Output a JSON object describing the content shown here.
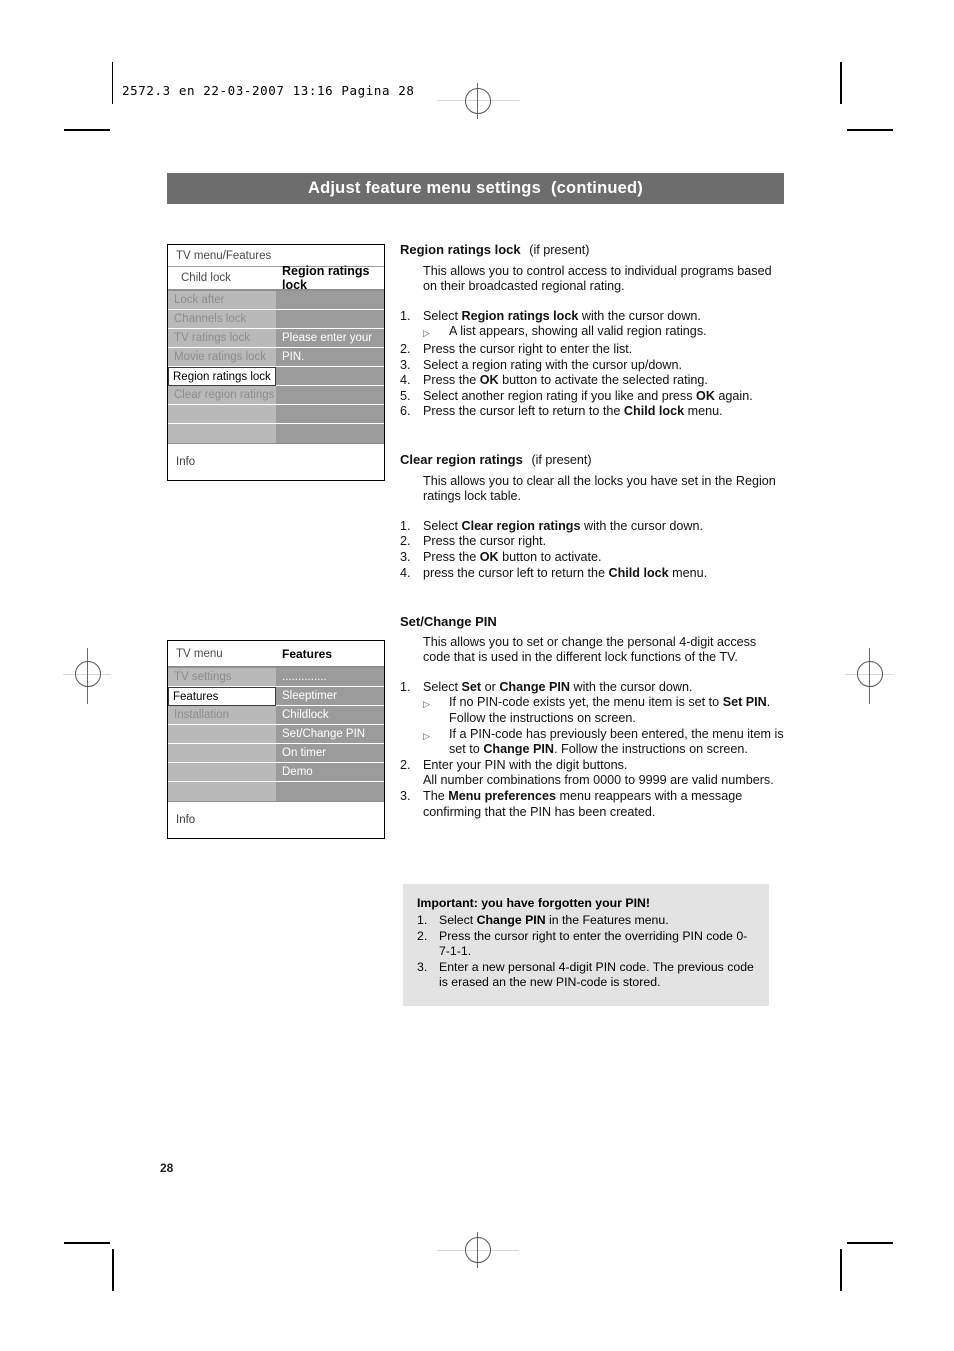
{
  "print_marks": {
    "job_code": "2572.3 en   22-03-2007   13:16   Pagina 28"
  },
  "header": {
    "title": "Adjust feature menu settings",
    "continued": "(continued)"
  },
  "page_number": "28",
  "menu_screens": [
    {
      "name": "region-ratings-lock-menu",
      "breadcrumb": "TV menu/Features",
      "header_left": "Child lock",
      "header_right": "Region ratings lock",
      "rows": [
        {
          "left": "Lock after",
          "right": "",
          "selected": false
        },
        {
          "left": "Channels lock",
          "right": "",
          "selected": false
        },
        {
          "left": "TV ratings lock",
          "right": "Please enter your",
          "selected": false
        },
        {
          "left": "Movie ratings lock",
          "right": "PIN.",
          "selected": false
        },
        {
          "left": "Region ratings lock",
          "right": "",
          "selected": true
        },
        {
          "left": "Clear region ratings",
          "right": "",
          "selected": false
        },
        {
          "left": "",
          "right": "",
          "selected": false
        },
        {
          "left": "",
          "right": "",
          "selected": false
        }
      ],
      "info": "Info"
    },
    {
      "name": "features-menu",
      "breadcrumb": "TV menu",
      "header_right": "Features",
      "rows": [
        {
          "left": "TV settings",
          "right": "..............",
          "selected": false
        },
        {
          "left": "Features",
          "right": "Sleeptimer",
          "selected": true
        },
        {
          "left": "Installation",
          "right": "Childlock",
          "selected": false
        },
        {
          "left": "",
          "right": "Set/Change PIN",
          "selected": false
        },
        {
          "left": "",
          "right": "On timer",
          "selected": false
        },
        {
          "left": "",
          "right": "Demo",
          "selected": false
        },
        {
          "left": "",
          "right": "",
          "selected": false
        }
      ],
      "info": "Info"
    }
  ],
  "sections": {
    "region_ratings_lock": {
      "heading": "Region ratings lock",
      "heading_note": "(if present)",
      "intro": "This allows you to control access to individual programs based on their broadcasted regional rating.",
      "steps": [
        {
          "num": "1.",
          "parts": [
            {
              "t": "Select "
            },
            {
              "t": "Region ratings lock",
              "b": true
            },
            {
              "t": " with the cursor down."
            }
          ]
        },
        {
          "sub": true,
          "parts": [
            {
              "t": "A list appears, showing all valid region ratings."
            }
          ]
        },
        {
          "num": "2.",
          "parts": [
            {
              "t": "Press the cursor right to enter the list."
            }
          ]
        },
        {
          "num": "3.",
          "parts": [
            {
              "t": "Select a region rating with the cursor up/down."
            }
          ]
        },
        {
          "num": "4.",
          "parts": [
            {
              "t": "Press the "
            },
            {
              "t": "OK",
              "b": true
            },
            {
              "t": " button to activate the selected rating."
            }
          ]
        },
        {
          "num": "5.",
          "parts": [
            {
              "t": "Select another region rating if you like and press "
            },
            {
              "t": "OK",
              "b": true
            },
            {
              "t": " again."
            }
          ]
        },
        {
          "num": "6.",
          "parts": [
            {
              "t": "Press the cursor left to return to the "
            },
            {
              "t": "Child lock",
              "b": true
            },
            {
              "t": " menu."
            }
          ]
        }
      ]
    },
    "clear_region_ratings": {
      "heading": "Clear region ratings",
      "heading_note": "(if present)",
      "intro": "This allows you to clear all the locks you have set in the Region ratings lock table.",
      "steps": [
        {
          "num": "1.",
          "parts": [
            {
              "t": "Select "
            },
            {
              "t": "Clear region ratings",
              "b": true
            },
            {
              "t": " with the cursor down."
            }
          ]
        },
        {
          "num": "2.",
          "parts": [
            {
              "t": "Press the cursor right."
            }
          ]
        },
        {
          "num": "3.",
          "parts": [
            {
              "t": "Press the "
            },
            {
              "t": "OK",
              "b": true
            },
            {
              "t": " button to activate."
            }
          ]
        },
        {
          "num": "4.",
          "parts": [
            {
              "t": "press the cursor left to return the "
            },
            {
              "t": "Child lock",
              "b": true
            },
            {
              "t": " menu."
            }
          ]
        }
      ]
    },
    "set_change_pin": {
      "heading": "Set/Change PIN",
      "heading_note": "",
      "intro": "This allows you to set or change the personal 4-digit access code that is used in the different lock functions of the TV.",
      "steps": [
        {
          "num": "1.",
          "parts": [
            {
              "t": "Select "
            },
            {
              "t": "Set",
              "b": true
            },
            {
              "t": " or "
            },
            {
              "t": "Change PIN",
              "b": true
            },
            {
              "t": " with the cursor down."
            }
          ]
        },
        {
          "sub": true,
          "parts": [
            {
              "t": "If no PIN-code exists yet, the menu item is set to "
            },
            {
              "t": "Set PIN",
              "b": true
            },
            {
              "t": ". Follow the instructions on screen."
            }
          ]
        },
        {
          "sub": true,
          "parts": [
            {
              "t": "If a PIN-code has previously been entered, the menu item is set to "
            },
            {
              "t": "Change PIN",
              "b": true
            },
            {
              "t": ". Follow the instructions on screen."
            }
          ]
        },
        {
          "num": "2.",
          "parts": [
            {
              "t": "Enter your PIN with the digit buttons.\nAll number combinations from 0000 to 9999 are valid numbers."
            }
          ]
        },
        {
          "num": "3.",
          "parts": [
            {
              "t": "The "
            },
            {
              "t": "Menu preferences",
              "b": true
            },
            {
              "t": " menu reappears with a message confirming that the PIN has been created."
            }
          ]
        }
      ]
    },
    "important_box": {
      "heading": "Important: you have forgotten your PIN!",
      "steps": [
        {
          "num": "1.",
          "parts": [
            {
              "t": "Select "
            },
            {
              "t": "Change PIN",
              "b": true
            },
            {
              "t": " in the Features menu."
            }
          ]
        },
        {
          "num": "2.",
          "parts": [
            {
              "t": "Press the cursor right to enter the overriding PIN code 0-7-1-1."
            }
          ]
        },
        {
          "num": "3.",
          "parts": [
            {
              "t": "Enter a new personal 4-digit PIN code. The previous code is erased an the new PIN-code is stored."
            }
          ]
        }
      ]
    }
  }
}
